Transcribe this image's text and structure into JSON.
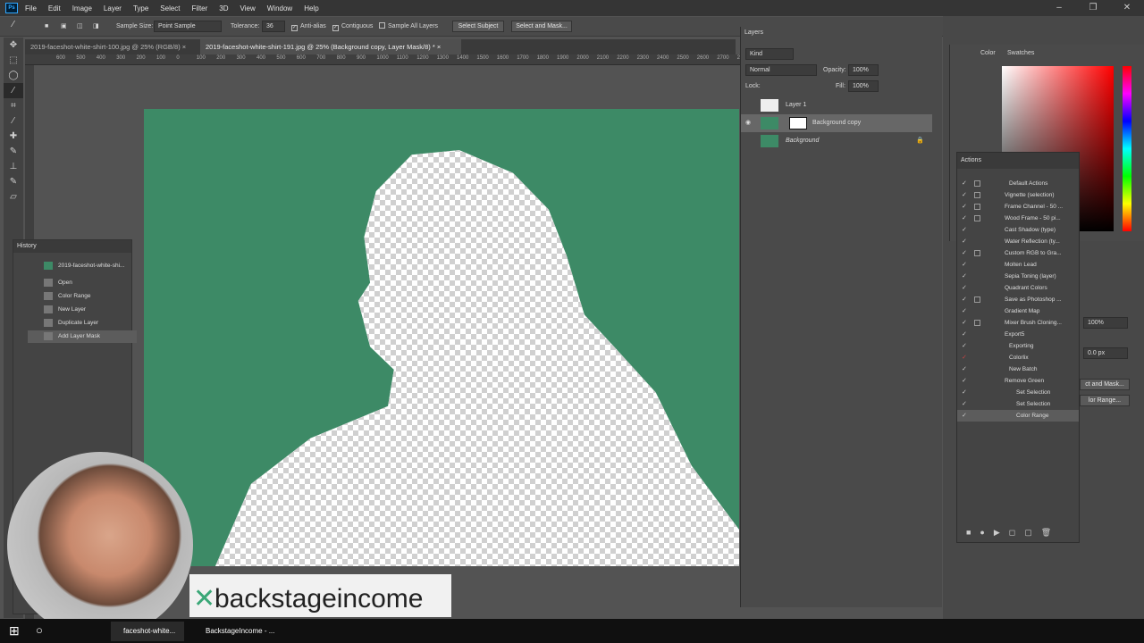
{
  "app": {
    "logo": "Ps"
  },
  "menu": [
    "File",
    "Edit",
    "Image",
    "Layer",
    "Type",
    "Select",
    "Filter",
    "3D",
    "View",
    "Window",
    "Help"
  ],
  "options": {
    "sample_size_label": "Sample Size:",
    "sample_size_value": "Point Sample",
    "tolerance_label": "Tolerance:",
    "tolerance_value": "36",
    "anti_alias": "Anti-alias",
    "contiguous": "Contiguous",
    "sample_all_layers": "Sample All Layers",
    "select_subject": "Select Subject",
    "select_and_mask": "Select and Mask..."
  },
  "tabs": [
    {
      "label": "2019-faceshot-white-shirt-100.jpg @ 25% (RGB/8)",
      "close": "×"
    },
    {
      "label": "2019-faceshot-white-shirt-191.jpg @ 25% (Background copy, Layer Mask/8) *",
      "close": "×"
    }
  ],
  "ruler_marks": [
    "600",
    "500",
    "400",
    "300",
    "200",
    "100",
    "0",
    "100",
    "200",
    "300",
    "400",
    "500",
    "600",
    "700",
    "800",
    "900",
    "1000",
    "1100",
    "1200",
    "1300",
    "1400",
    "1500",
    "1600",
    "1700",
    "1800",
    "1900",
    "2000",
    "2100",
    "2200",
    "2300",
    "2400",
    "2500",
    "2600",
    "2700",
    "2800",
    "2900"
  ],
  "history": {
    "title": "History",
    "snapshot": "2019-faceshot-white-shi...",
    "items": [
      "Open",
      "Color Range",
      "New Layer",
      "Duplicate Layer",
      "Add Layer Mask"
    ]
  },
  "layers": {
    "title": "Layers",
    "filter": "Kind",
    "blend_mode": "Normal",
    "opacity_label": "Opacity:",
    "opacity_value": "100%",
    "lock_label": "Lock:",
    "fill_label": "Fill:",
    "fill_value": "100%",
    "items": [
      "Layer 1",
      "Background copy",
      "Background"
    ]
  },
  "color_panel": {
    "tabs": [
      "Color",
      "Swatches"
    ]
  },
  "properties": {
    "zoom": "100%",
    "feather": "0.0 px",
    "select_mask": "ct and Mask...",
    "color_range": "lor Range..."
  },
  "actions": {
    "title": "Actions",
    "items": [
      "Default Actions",
      "Vignette (selection)",
      "Frame Channel - 50 ...",
      "Wood Frame - 50 pi...",
      "Cast Shadow (type)",
      "Water Reflection (ty...",
      "Custom RGB to Gra...",
      "Molten Lead",
      "Sepia Toning (layer)",
      "Quadrant Colors",
      "Save as Photoshop ...",
      "Gradient Map",
      "Mixer Brush Cloning...",
      "Export5",
      "Exporting",
      "Colorlix",
      "New Batch",
      "Remove Green",
      "Set Selection",
      "Set Selection",
      "Color Range"
    ]
  },
  "brand": {
    "text": "backstageincome"
  },
  "taskbar": {
    "item1": "faceshot-white...",
    "item2": "BackstageIncome - ..."
  },
  "colors": {
    "accent": "#31a8ff",
    "canvas_green": "#3d8a66",
    "brand_green": "#3aa777"
  }
}
